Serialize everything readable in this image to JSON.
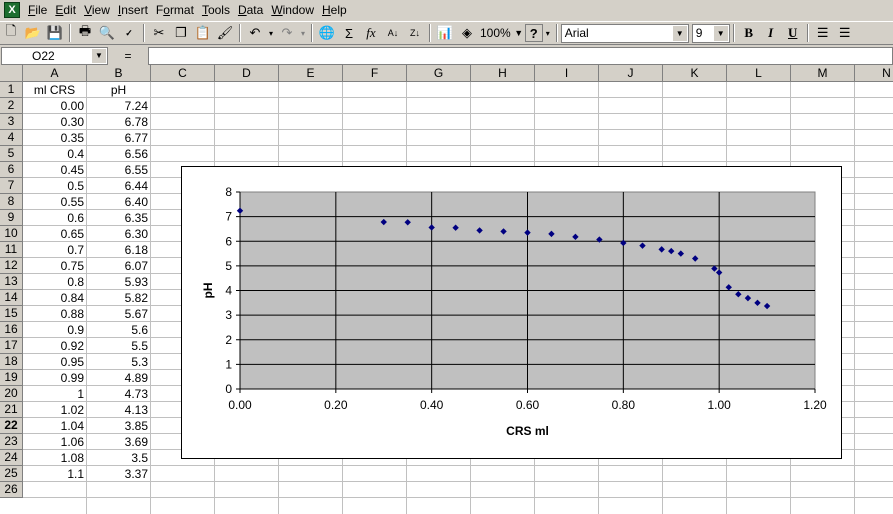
{
  "menu": {
    "items": [
      {
        "key": "F",
        "rest": "ile"
      },
      {
        "key": "E",
        "rest": "dit"
      },
      {
        "key": "V",
        "rest": "iew"
      },
      {
        "key": "I",
        "rest": "nsert"
      },
      {
        "key": "",
        "pre": "F",
        "key2": "o",
        "rest": "rmat"
      },
      {
        "key": "T",
        "rest": "ools"
      },
      {
        "key": "D",
        "rest": "ata"
      },
      {
        "key": "W",
        "rest": "indow"
      },
      {
        "key": "H",
        "rest": "elp"
      }
    ]
  },
  "toolbar": {
    "zoom": "100%",
    "font_name": "Arial",
    "font_size": "9",
    "bold": "B",
    "italic": "I",
    "underline": "U",
    "sigma": "Σ",
    "fx": "fx"
  },
  "formula_bar": {
    "name_box": "O22",
    "equals": "="
  },
  "sheet": {
    "columns": [
      "A",
      "B",
      "C",
      "D",
      "E",
      "F",
      "G",
      "H",
      "I",
      "J",
      "K",
      "L",
      "M",
      "N"
    ],
    "rows": [
      "1",
      "2",
      "3",
      "4",
      "5",
      "6",
      "7",
      "8",
      "9",
      "10",
      "11",
      "12",
      "13",
      "14",
      "15",
      "16",
      "17",
      "18",
      "19",
      "20",
      "21",
      "22",
      "23",
      "24",
      "25",
      "26"
    ],
    "active_row": "22",
    "header_a": "ml CRS",
    "header_b": "pH",
    "col_a": [
      "0.00",
      "0.30",
      "0.35",
      "0.4",
      "0.45",
      "0.5",
      "0.55",
      "0.6",
      "0.65",
      "0.7",
      "0.75",
      "0.8",
      "0.84",
      "0.88",
      "0.9",
      "0.92",
      "0.95",
      "0.99",
      "1",
      "1.02",
      "1.04",
      "1.06",
      "1.08",
      "1.1"
    ],
    "col_b": [
      "7.24",
      "6.78",
      "6.77",
      "6.56",
      "6.55",
      "6.44",
      "6.40",
      "6.35",
      "6.30",
      "6.18",
      "6.07",
      "5.93",
      "5.82",
      "5.67",
      "5.6",
      "5.5",
      "5.3",
      "4.89",
      "4.73",
      "4.13",
      "3.85",
      "3.69",
      "3.5",
      "3.37"
    ]
  },
  "chart_data": {
    "type": "scatter",
    "xlabel": "CRS ml",
    "ylabel": "pH",
    "xlim": [
      0,
      1.2
    ],
    "ylim": [
      0,
      8
    ],
    "x_ticks": [
      "0.00",
      "0.20",
      "0.40",
      "0.60",
      "0.80",
      "1.00",
      "1.20"
    ],
    "y_ticks": [
      "0",
      "1",
      "2",
      "3",
      "4",
      "5",
      "6",
      "7",
      "8"
    ],
    "grid": true,
    "plot_bg": "#c0c0c0",
    "marker_color": "#000080",
    "series": [
      {
        "x": [
          0.0,
          0.3,
          0.35,
          0.4,
          0.45,
          0.5,
          0.55,
          0.6,
          0.65,
          0.7,
          0.75,
          0.8,
          0.84,
          0.88,
          0.9,
          0.92,
          0.95,
          0.99,
          1.0,
          1.02,
          1.04,
          1.06,
          1.08,
          1.1
        ],
        "y": [
          7.24,
          6.78,
          6.77,
          6.56,
          6.55,
          6.44,
          6.4,
          6.35,
          6.3,
          6.18,
          6.07,
          5.93,
          5.82,
          5.67,
          5.6,
          5.5,
          5.3,
          4.89,
          4.73,
          4.13,
          3.85,
          3.69,
          3.5,
          3.37
        ]
      }
    ]
  }
}
